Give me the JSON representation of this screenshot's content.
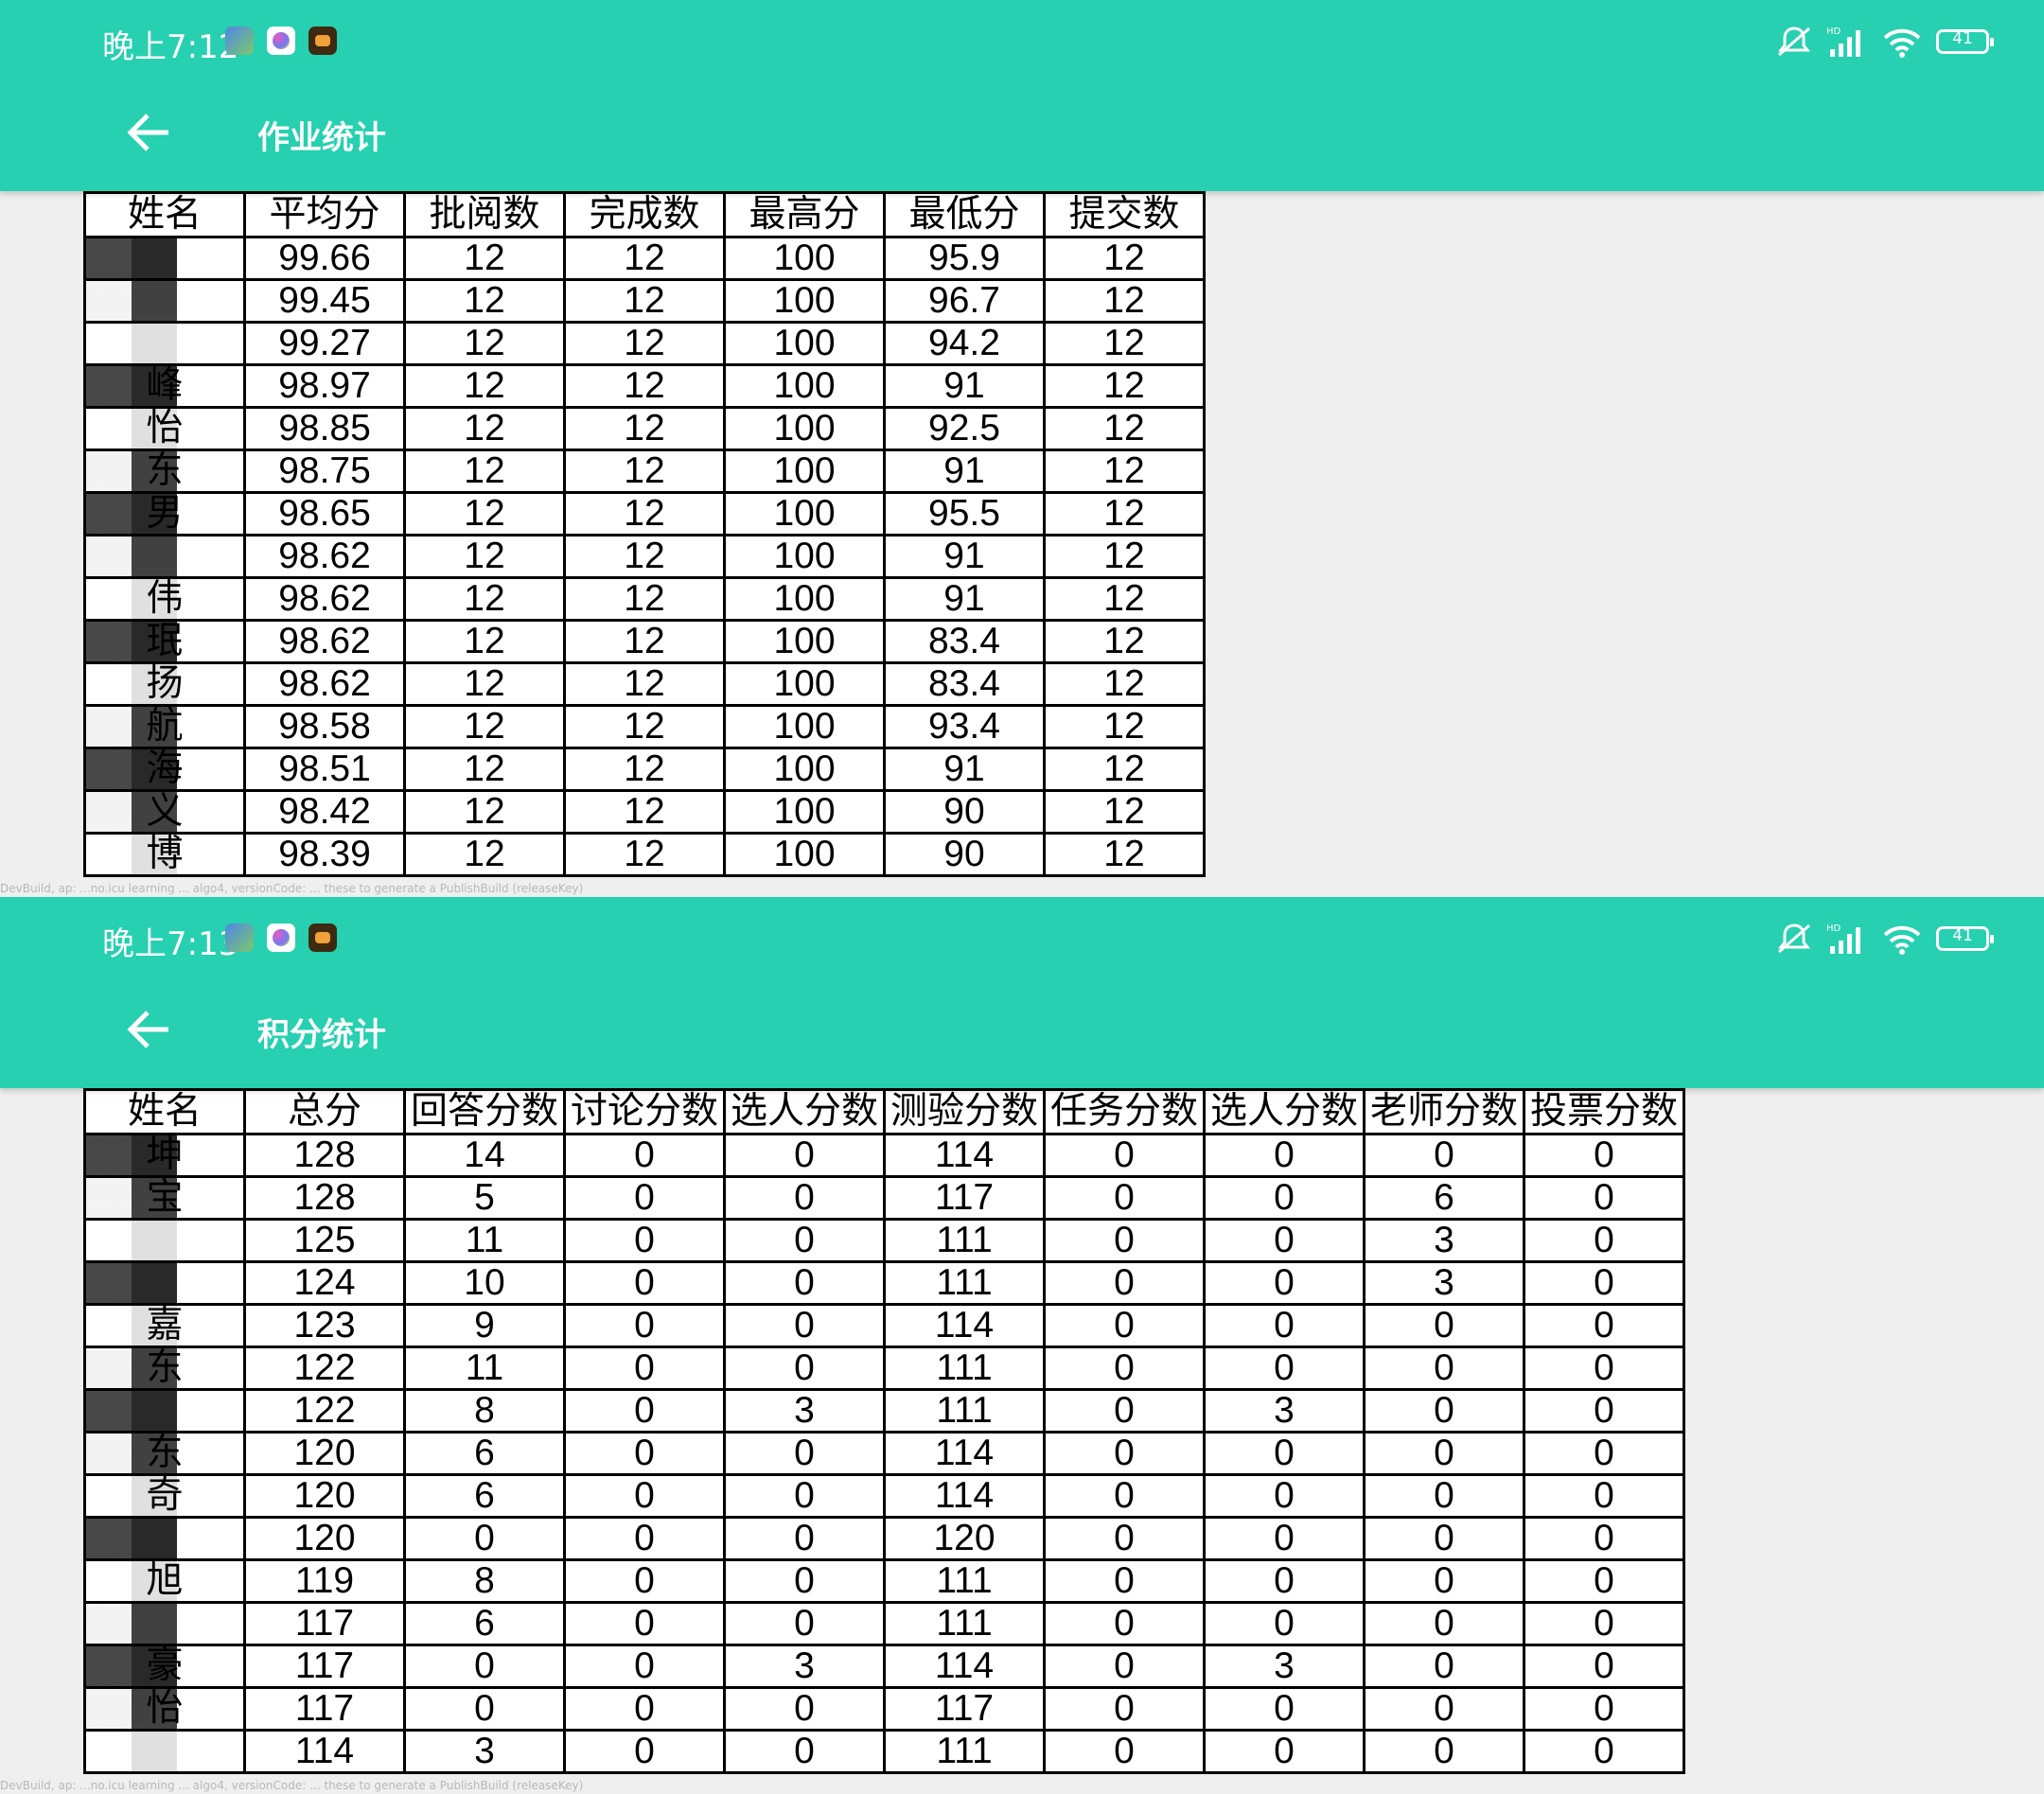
{
  "screens": [
    {
      "status_time": "晚上7:12",
      "battery": "41",
      "title": "作业统计",
      "headers": [
        "姓名",
        "平均分",
        "批阅数",
        "完成数",
        "最高分",
        "最低分",
        "提交数"
      ],
      "rows": [
        [
          "",
          "99.66",
          "12",
          "12",
          "100",
          "95.9",
          "12"
        ],
        [
          "",
          "99.45",
          "12",
          "12",
          "100",
          "96.7",
          "12"
        ],
        [
          "",
          "99.27",
          "12",
          "12",
          "100",
          "94.2",
          "12"
        ],
        [
          "峰",
          "98.97",
          "12",
          "12",
          "100",
          "91",
          "12"
        ],
        [
          "怡",
          "98.85",
          "12",
          "12",
          "100",
          "92.5",
          "12"
        ],
        [
          "东",
          "98.75",
          "12",
          "12",
          "100",
          "91",
          "12"
        ],
        [
          "男",
          "98.65",
          "12",
          "12",
          "100",
          "95.5",
          "12"
        ],
        [
          "",
          "98.62",
          "12",
          "12",
          "100",
          "91",
          "12"
        ],
        [
          "伟",
          "98.62",
          "12",
          "12",
          "100",
          "91",
          "12"
        ],
        [
          "珉",
          "98.62",
          "12",
          "12",
          "100",
          "83.4",
          "12"
        ],
        [
          "扬",
          "98.62",
          "12",
          "12",
          "100",
          "83.4",
          "12"
        ],
        [
          "航",
          "98.58",
          "12",
          "12",
          "100",
          "93.4",
          "12"
        ],
        [
          "海",
          "98.51",
          "12",
          "12",
          "100",
          "91",
          "12"
        ],
        [
          "义",
          "98.42",
          "12",
          "12",
          "100",
          "90",
          "12"
        ],
        [
          "博",
          "98.39",
          "12",
          "12",
          "100",
          "90",
          "12"
        ]
      ],
      "watermark": "DevBuild, ap: ...no.icu learning ... algo4, versionCode: ... these to generate a PublishBuild (releaseKey)"
    },
    {
      "status_time": "晚上7:13",
      "battery": "41",
      "title": "积分统计",
      "headers": [
        "姓名",
        "总分",
        "回答分数",
        "讨论分数",
        "选人分数",
        "测验分数",
        "任务分数",
        "选人分数",
        "老师分数",
        "投票分数"
      ],
      "rows": [
        [
          "坤",
          "128",
          "14",
          "0",
          "0",
          "114",
          "0",
          "0",
          "0",
          "0"
        ],
        [
          "宝",
          "128",
          "5",
          "0",
          "0",
          "117",
          "0",
          "0",
          "6",
          "0"
        ],
        [
          "",
          "125",
          "11",
          "0",
          "0",
          "111",
          "0",
          "0",
          "3",
          "0"
        ],
        [
          "",
          "124",
          "10",
          "0",
          "0",
          "111",
          "0",
          "0",
          "3",
          "0"
        ],
        [
          "嘉",
          "123",
          "9",
          "0",
          "0",
          "114",
          "0",
          "0",
          "0",
          "0"
        ],
        [
          "东",
          "122",
          "11",
          "0",
          "0",
          "111",
          "0",
          "0",
          "0",
          "0"
        ],
        [
          "",
          "122",
          "8",
          "0",
          "3",
          "111",
          "0",
          "3",
          "0",
          "0"
        ],
        [
          "东",
          "120",
          "6",
          "0",
          "0",
          "114",
          "0",
          "0",
          "0",
          "0"
        ],
        [
          "奇",
          "120",
          "6",
          "0",
          "0",
          "114",
          "0",
          "0",
          "0",
          "0"
        ],
        [
          "",
          "120",
          "0",
          "0",
          "0",
          "120",
          "0",
          "0",
          "0",
          "0"
        ],
        [
          "旭",
          "119",
          "8",
          "0",
          "0",
          "111",
          "0",
          "0",
          "0",
          "0"
        ],
        [
          "",
          "117",
          "6",
          "0",
          "0",
          "111",
          "0",
          "0",
          "0",
          "0"
        ],
        [
          "豪",
          "117",
          "0",
          "0",
          "3",
          "114",
          "0",
          "3",
          "0",
          "0"
        ],
        [
          "怡",
          "117",
          "0",
          "0",
          "0",
          "117",
          "0",
          "0",
          "0",
          "0"
        ],
        [
          "",
          "114",
          "3",
          "0",
          "0",
          "111",
          "0",
          "0",
          "0",
          "0"
        ]
      ],
      "watermark": "DevBuild, ap: ...no.icu learning ... algo4, versionCode: ... these to generate a PublishBuild (releaseKey)"
    }
  ]
}
